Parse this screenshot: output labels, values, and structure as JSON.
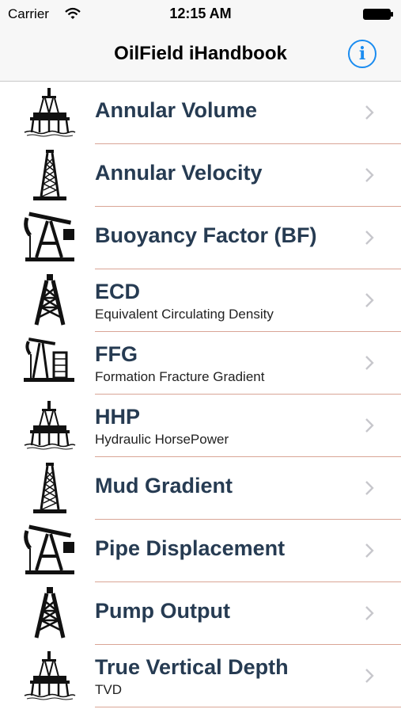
{
  "status": {
    "carrier": "Carrier",
    "time": "12:15 AM"
  },
  "nav": {
    "title": "OilField iHandbook",
    "info_icon": "info-icon"
  },
  "accent_color": "#1a8cf0",
  "items": [
    {
      "title": "Annular Volume",
      "subtitle": "",
      "icon": "offshore-platform-icon"
    },
    {
      "title": "Annular Velocity",
      "subtitle": "",
      "icon": "drilling-derrick-icon"
    },
    {
      "title": "Buoyancy Factor (BF)",
      "subtitle": "",
      "icon": "pumpjack-icon"
    },
    {
      "title": "ECD",
      "subtitle": "Equivalent Circulating Density",
      "icon": "rig-tower-icon"
    },
    {
      "title": "FFG",
      "subtitle": "Formation Fracture Gradient",
      "icon": "pumpjack-tank-icon"
    },
    {
      "title": "HHP",
      "subtitle": "Hydraulic HorsePower",
      "icon": "offshore-platform-icon"
    },
    {
      "title": "Mud Gradient",
      "subtitle": "",
      "icon": "drilling-derrick-icon"
    },
    {
      "title": "Pipe Displacement",
      "subtitle": "",
      "icon": "pumpjack-icon"
    },
    {
      "title": "Pump Output",
      "subtitle": "",
      "icon": "rig-tower-icon"
    },
    {
      "title": "True Vertical Depth",
      "subtitle": "TVD",
      "icon": "offshore-platform-icon"
    }
  ]
}
